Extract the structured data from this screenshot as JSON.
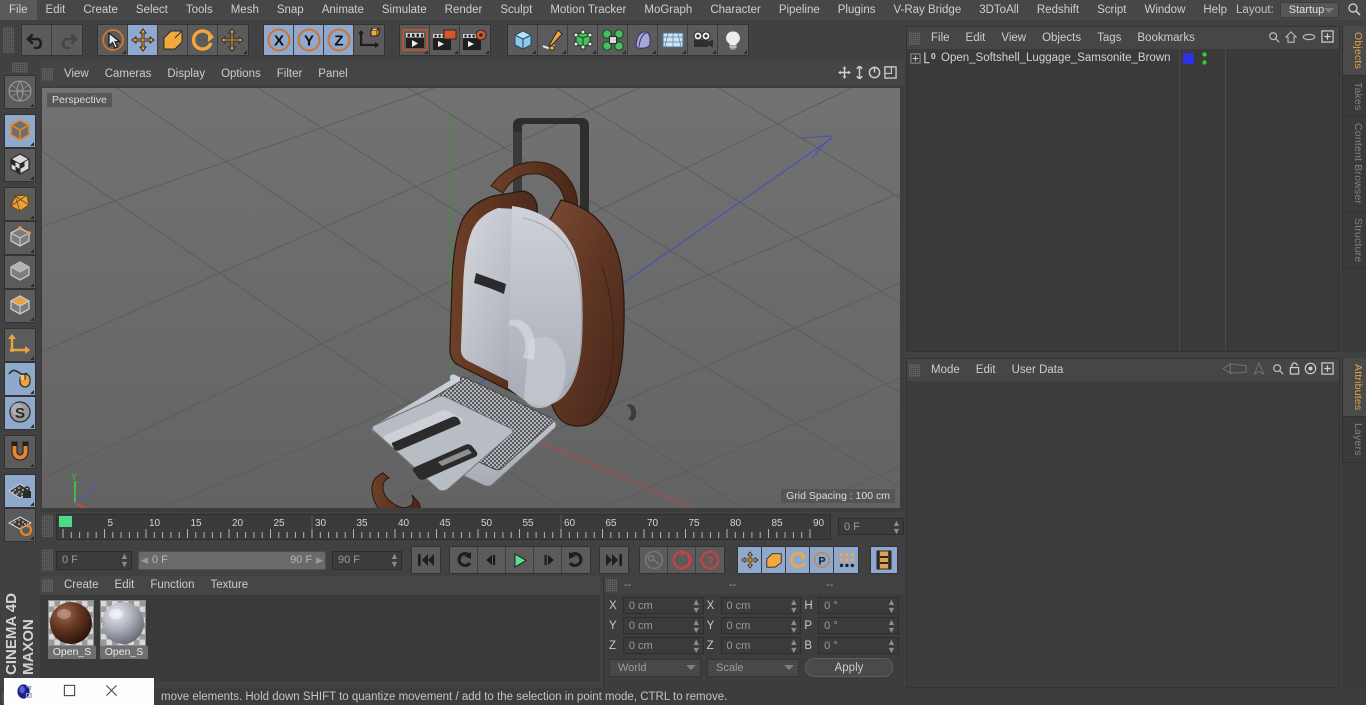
{
  "app": {
    "name": "CINEMA 4D",
    "brand": "MAXON"
  },
  "menubar": {
    "items": [
      "File",
      "Edit",
      "Create",
      "Select",
      "Tools",
      "Mesh",
      "Snap",
      "Animate",
      "Simulate",
      "Render",
      "Sculpt",
      "Motion Tracker",
      "MoGraph",
      "Character",
      "Pipeline",
      "Plugins",
      "V-Ray Bridge",
      "3DToAll",
      "Redshift",
      "Script",
      "Window",
      "Help"
    ],
    "layout_label": "Layout:",
    "layout_value": "Startup",
    "search_icon": "search-icon"
  },
  "toolbar": {
    "undo": "undo-icon",
    "redo": "redo-icon",
    "select": "live-selection-icon",
    "move": "move-icon",
    "scale": "scale-icon",
    "rotate": "rotate-icon",
    "move_axis": "move-axis-icon",
    "axis_x": "X",
    "axis_y": "Y",
    "axis_z": "Z",
    "world_axis": "world-object-axis-icon",
    "render_view": "render-view-icon",
    "render_region": "render-region-icon",
    "render_settings": "render-settings-icon",
    "cube": "add-cube-icon",
    "spline": "add-spline-icon",
    "generator": "add-generator-icon",
    "mograph": "add-mograph-icon",
    "deformer": "add-deformer-icon",
    "environment": "add-environment-icon",
    "camera": "add-camera-icon",
    "light": "add-light-icon"
  },
  "left_toolbar": {
    "items": [
      {
        "name": "make-editable-icon"
      },
      {
        "name": "model-mode-icon",
        "selected": true
      },
      {
        "name": "texture-mode-icon"
      },
      {
        "name": "points-mode-icon"
      },
      {
        "name": "edges-mode-icon"
      },
      {
        "name": "polygons-mode-icon"
      },
      {
        "name": "surface-mode-icon"
      },
      {
        "name": "axis-mode-icon"
      },
      {
        "name": "enable-axis-icon",
        "selected": true
      },
      {
        "name": "soft-selection-icon",
        "selected": true
      },
      {
        "name": "snap-magnet-icon"
      },
      {
        "name": "workplane-lock-icon",
        "selected": true
      },
      {
        "name": "workplane-rotate-icon"
      }
    ]
  },
  "viewport": {
    "menu": [
      "View",
      "Cameras",
      "Display",
      "Options",
      "Filter",
      "Panel"
    ],
    "label": "Perspective",
    "grid_spacing": "Grid Spacing : 100 cm",
    "axis_labels": {
      "x": "X",
      "y": "Y",
      "z": "Z"
    },
    "corner_icons": [
      "viewport-move-icon",
      "viewport-scale-icon",
      "viewport-rotate-icon",
      "viewport-maximize-icon"
    ],
    "model_name": "open-softshell-luggage"
  },
  "object_manager": {
    "menu": [
      "File",
      "Edit",
      "View",
      "Objects",
      "Tags",
      "Bookmarks"
    ],
    "header_icons": [
      "search-icon",
      "home-icon",
      "ellipse-icon",
      "plus-box-icon"
    ],
    "objects": [
      {
        "name": "Open_Softshell_Luggage_Samsonite_Brown",
        "layer": "0",
        "color": "#2b33e0",
        "dots": "#33cc33"
      }
    ]
  },
  "attributes": {
    "menu": [
      "Mode",
      "Edit",
      "User Data"
    ],
    "header_icons": [
      "nav-left-icon",
      "nav-up-icon",
      "search-icon",
      "lock-icon",
      "target-icon",
      "plus-box-icon"
    ]
  },
  "right_tabs": {
    "top": [
      "Objects",
      "Takes",
      "Content Browser",
      "Structure"
    ],
    "top_active": "Objects",
    "bottom": [
      "Attributes",
      "Layers"
    ],
    "bottom_active": "Attributes"
  },
  "timeline": {
    "ticks": [
      "0",
      "5",
      "10",
      "15",
      "20",
      "25",
      "30",
      "35",
      "40",
      "45",
      "50",
      "55",
      "60",
      "65",
      "70",
      "75",
      "80",
      "85",
      "90"
    ],
    "current_frame_marker": "0",
    "frame_field_right": "0 F",
    "current_frame": "0 F",
    "range_start": "0 F",
    "range_end": "90 F",
    "end_frame": "90 F",
    "buttons": [
      "go-to-start-icon",
      "play-reverse-step-icon",
      "step-back-icon",
      "play-icon",
      "step-forward-icon",
      "loop-icon",
      "go-to-end-icon"
    ],
    "record_buttons": [
      "autokey-icon",
      "record-icon",
      "keyframe-help-icon"
    ],
    "key_toggles": [
      "key-position-icon",
      "key-scale-icon",
      "key-rotation-icon",
      "key-param-icon",
      "key-pla-icon"
    ],
    "timeline_mode_icon": "timeline-mode-icon"
  },
  "material_manager": {
    "menu": [
      "Create",
      "Edit",
      "Function",
      "Texture"
    ],
    "materials": [
      {
        "label": "Open_S",
        "color": "#5b2f22",
        "type": "brown-leather"
      },
      {
        "label": "Open_S",
        "color": "#9fa3b0",
        "type": "grey-fabric"
      }
    ]
  },
  "coordinates": {
    "col_headers": [
      "--",
      "--",
      "--"
    ],
    "rows": [
      {
        "l1": "X",
        "v1": "0 cm",
        "l2": "X",
        "v2": "0 cm",
        "l3": "H",
        "v3": "0 °"
      },
      {
        "l1": "Y",
        "v1": "0 cm",
        "l2": "Y",
        "v2": "0 cm",
        "l3": "P",
        "v3": "0 °"
      },
      {
        "l1": "Z",
        "v1": "0 cm",
        "l2": "Z",
        "v2": "0 cm",
        "l3": "B",
        "v3": "0 °"
      }
    ],
    "space": "World",
    "mode": "Scale",
    "apply": "Apply"
  },
  "statusbar": {
    "text": "move elements. Hold down SHIFT to quantize movement / add to the selection in point mode, CTRL to remove."
  },
  "overlay_window": {
    "icon": "c4d-blue-icon",
    "restore": "restore-icon",
    "maximize": "maximize-icon",
    "close": "close-icon"
  },
  "colors": {
    "accent_orange": "#e8a33d",
    "selection_blue": "#8fa8cd",
    "axis_x": "#c8434a",
    "axis_y": "#46c246",
    "axis_z": "#4a55d0",
    "panel_bg": "#414141",
    "viewport_bg": "#6d6d6d"
  }
}
